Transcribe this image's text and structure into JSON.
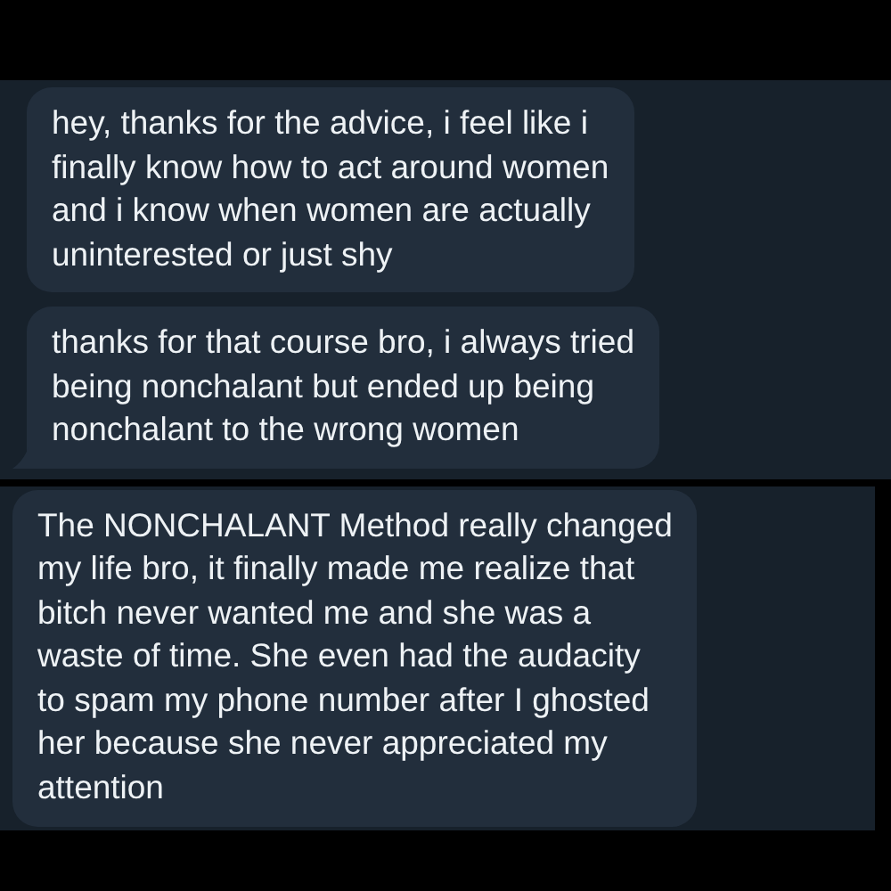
{
  "screenshots": [
    {
      "messages": [
        {
          "text": "hey, thanks for the advice, i feel like i\nfinally know how to act around women\nand i know when women are actually\nuninterested or just shy",
          "tail": false
        },
        {
          "text": "thanks for that course bro, i always tried\nbeing nonchalant but ended up being\nnonchalant to the wrong women",
          "tail": true
        }
      ]
    },
    {
      "messages": [
        {
          "text": "The NONCHALANT Method really changed\nmy life bro, it finally made me realize that\nbitch never wanted me and she was a\nwaste of time. She even had the audacity\nto spam my phone number after I ghosted\nher because she never appreciated my\nattention",
          "tail": false
        }
      ]
    }
  ]
}
